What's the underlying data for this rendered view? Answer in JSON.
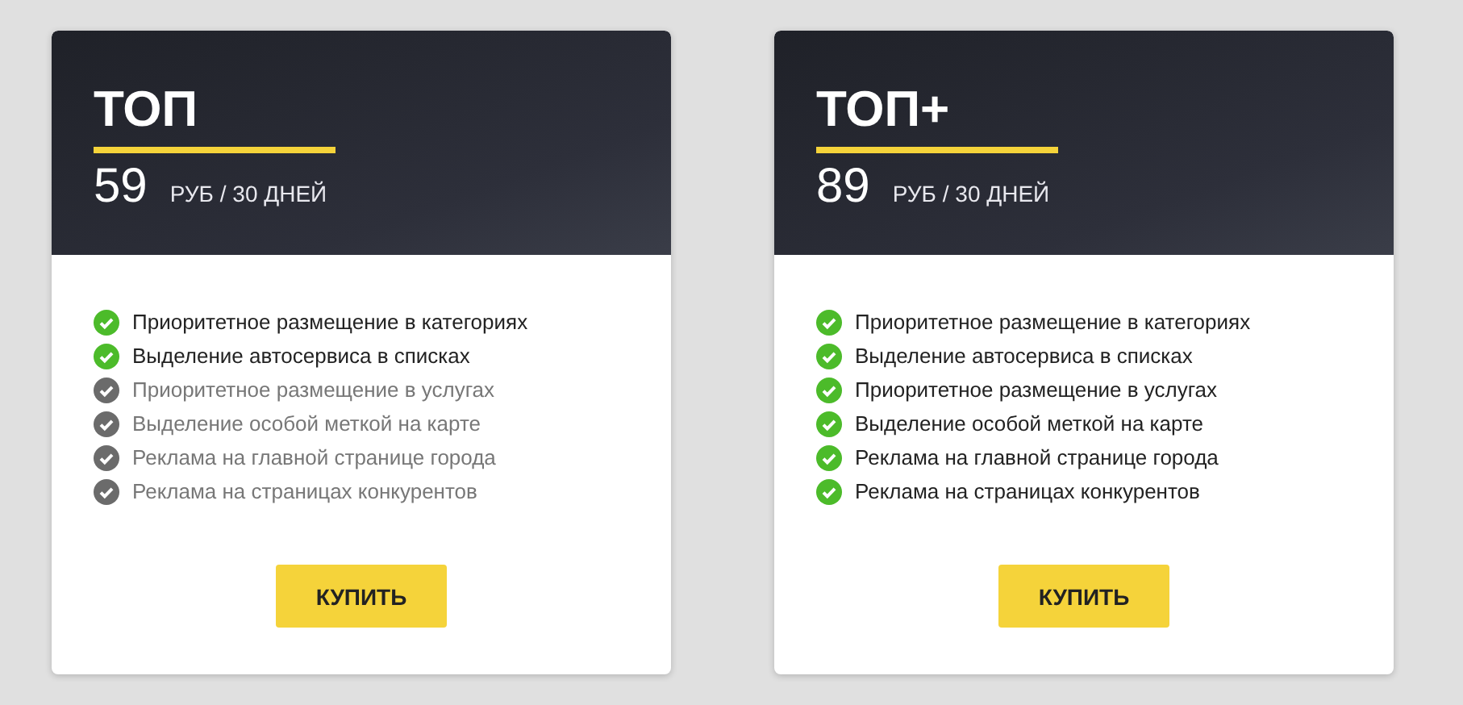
{
  "plans": [
    {
      "name": "ТОП",
      "price": "59",
      "period": "РУБ / 30 ДНЕЙ",
      "button": "КУПИТЬ",
      "features": [
        {
          "label": "Приоритетное размещение в категориях",
          "included": true
        },
        {
          "label": "Выделение автосервиса в списках",
          "included": true
        },
        {
          "label": "Приоритетное размещение в услугах",
          "included": false
        },
        {
          "label": "Выделение особой меткой на карте",
          "included": false
        },
        {
          "label": "Реклама на главной странице города",
          "included": false
        },
        {
          "label": "Реклама на страницах конкурентов",
          "included": false
        }
      ]
    },
    {
      "name": "ТОП+",
      "price": "89",
      "period": "РУБ / 30 ДНЕЙ",
      "button": "КУПИТЬ",
      "features": [
        {
          "label": "Приоритетное размещение в категориях",
          "included": true
        },
        {
          "label": "Выделение автосервиса в списках",
          "included": true
        },
        {
          "label": "Приоритетное размещение в услугах",
          "included": true
        },
        {
          "label": "Выделение особой меткой на карте",
          "included": true
        },
        {
          "label": "Реклама на главной странице города",
          "included": true
        },
        {
          "label": "Реклама на страницах конкурентов",
          "included": true
        }
      ]
    }
  ]
}
